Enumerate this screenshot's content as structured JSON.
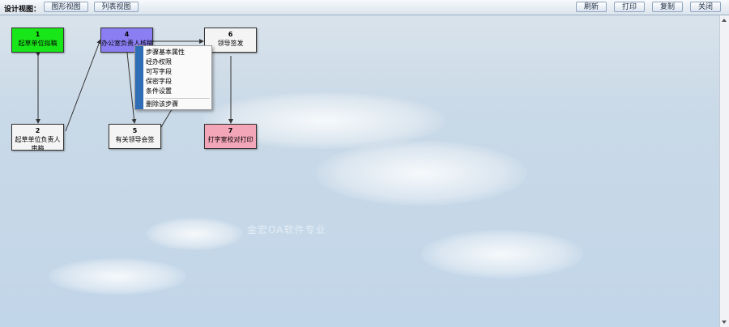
{
  "toolbar": {
    "label": "设计视图：",
    "view_buttons": [
      "图形视图",
      "列表视图"
    ],
    "action_buttons": [
      "刷新",
      "打印",
      "复制",
      "关闭"
    ]
  },
  "nodes": [
    {
      "num": "1",
      "label": "起草单位拟稿",
      "color": "#19e619"
    },
    {
      "num": "2",
      "label": "起草单位负责人审稿",
      "color": "#f4f4f4"
    },
    {
      "num": "4",
      "label": "办公室负责人核稿",
      "color": "#8a7ef2"
    },
    {
      "num": "5",
      "label": "有关领导会签",
      "color": "#f4f4f4"
    },
    {
      "num": "6",
      "label": "领导签发",
      "color": "#f4f4f4"
    },
    {
      "num": "7",
      "label": "打字室校对打印",
      "color": "#f3a6b8"
    }
  ],
  "context_menu": {
    "items": [
      "步骤基本属性",
      "经办权限",
      "可写字段",
      "保密字段",
      "条件设置"
    ],
    "danger_item": "删除该步骤"
  },
  "watermark": "金宏OA软件专业"
}
